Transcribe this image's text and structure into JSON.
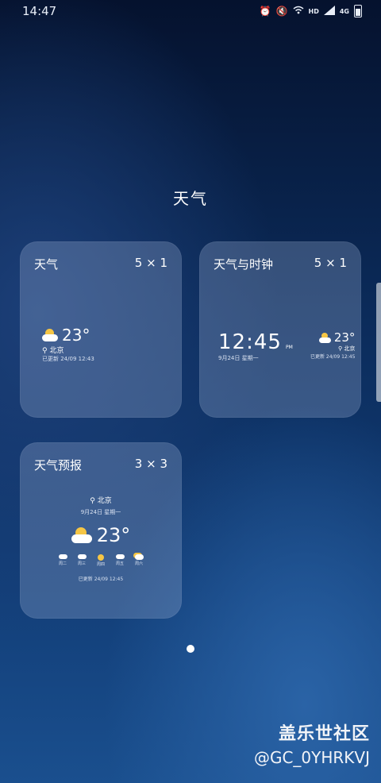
{
  "status_bar": {
    "time": "14:47",
    "network": "4G",
    "hd": "HD"
  },
  "page": {
    "title": "天气"
  },
  "widgets": [
    {
      "title": "天气",
      "size": "5 × 1",
      "temperature": "23°",
      "location": "北京",
      "updated": "已更新 24/09 12:43"
    },
    {
      "title": "天气与时钟",
      "size": "5 × 1",
      "time": "12:45",
      "ampm": "PM",
      "date": "9月24日 星期一",
      "temperature": "23°",
      "location": "北京",
      "updated": "已更新 24/09 12:45"
    },
    {
      "title": "天气预报",
      "size": "3 × 3",
      "location": "北京",
      "date": "9月24日 星期一",
      "temperature": "23°",
      "forecast_days": [
        "周二",
        "周三",
        "周四",
        "周五",
        "周六"
      ],
      "updated": "已更新 24/09 12:45"
    }
  ],
  "watermark": {
    "title": "盖乐世社区",
    "user": "@GC_0YHRKVJ"
  }
}
